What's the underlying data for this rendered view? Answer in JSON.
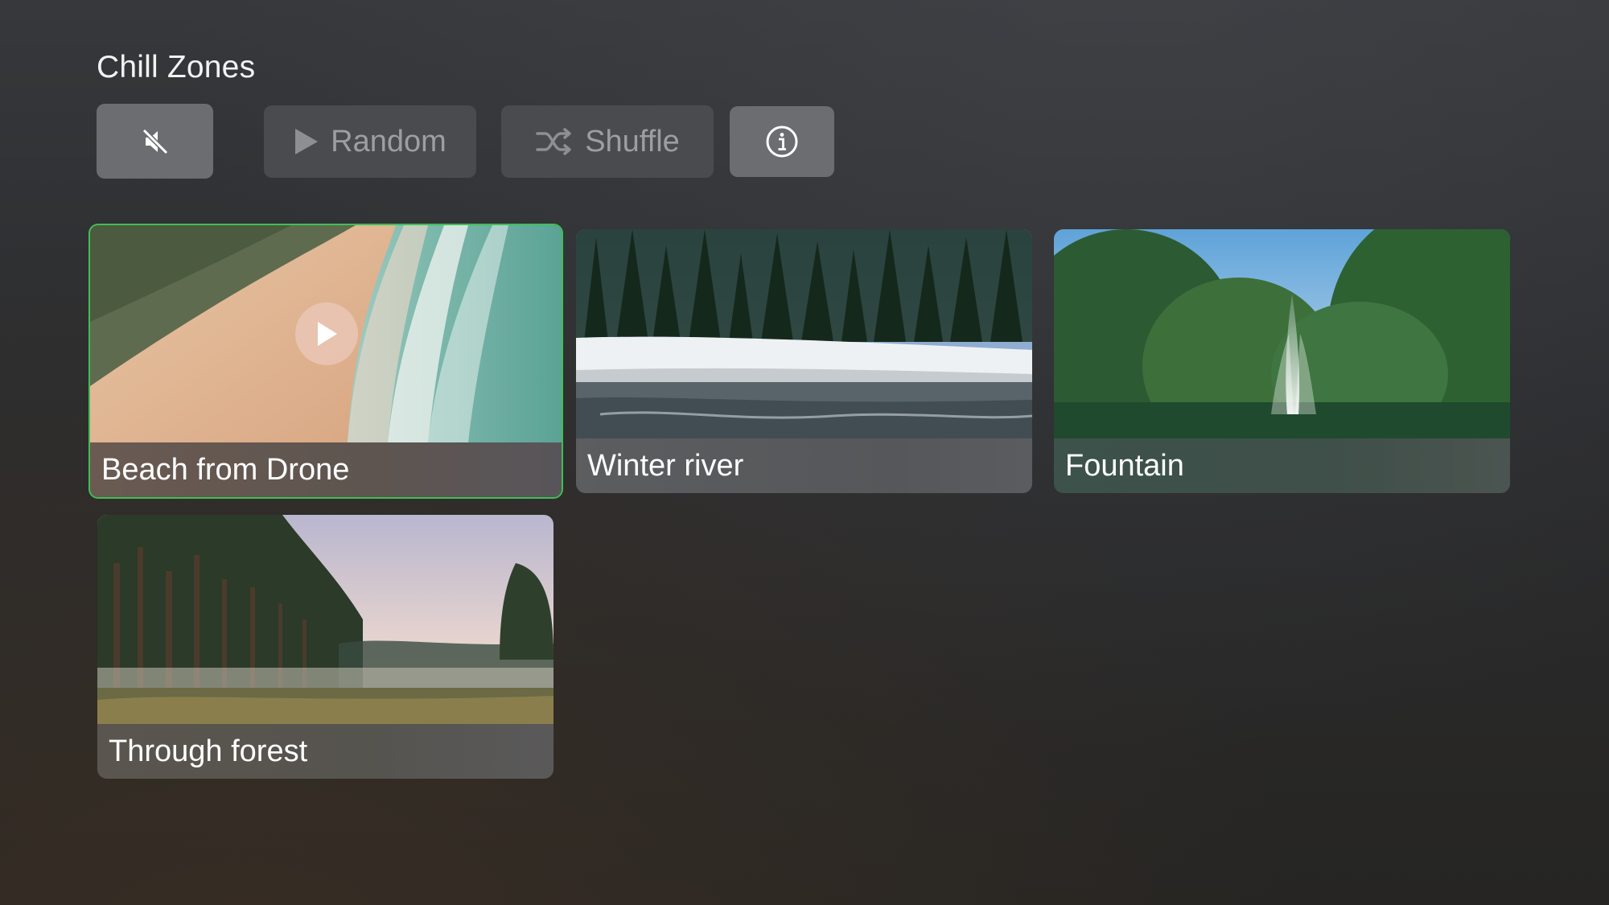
{
  "app": {
    "title": "Chill Zones"
  },
  "toolbar": {
    "mute_icon": "speaker-muted-icon",
    "random_label": "Random",
    "random_icon": "play-icon",
    "shuffle_label": "Shuffle",
    "shuffle_icon": "shuffle-icon",
    "info_icon": "info-icon"
  },
  "videos": [
    {
      "title": "Beach from Drone",
      "focused": true,
      "accent": "#3fbf55"
    },
    {
      "title": "Winter river",
      "focused": false
    },
    {
      "title": "Fountain",
      "focused": false
    },
    {
      "title": "Through forest",
      "focused": false
    }
  ]
}
